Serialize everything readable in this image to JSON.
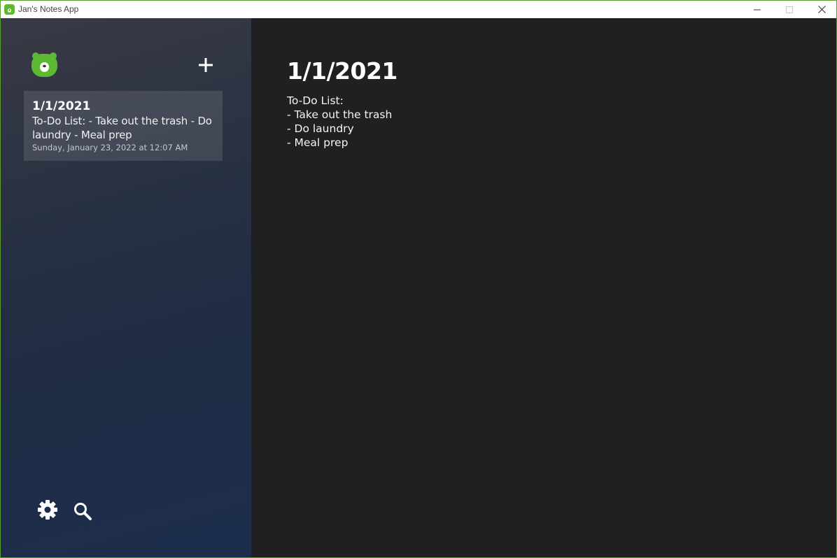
{
  "window": {
    "title": "Jan's Notes App",
    "border_color": "#5a9e2e",
    "controls": [
      "minimize-icon",
      "maximize-icon",
      "close-icon"
    ]
  },
  "sidebar": {
    "logo": "bear-logo-icon",
    "add_button_icon": "plus-icon",
    "notes": [
      {
        "title": "1/1/2021",
        "preview": "To-Do List: - Take out the trash - Do laundry - Meal prep",
        "date": "Sunday, January 23, 2022 at 12:07 AM"
      }
    ],
    "footer": {
      "settings_icon": "gear-icon",
      "search_icon": "search-icon"
    }
  },
  "editor": {
    "title": "1/1/2021",
    "body_lines": [
      "To-Do List:",
      "- Take out the trash",
      "- Do laundry",
      "- Meal prep"
    ]
  },
  "colors": {
    "accent": "#5fb832",
    "editor_bg": "#202020",
    "text": "#ffffff"
  }
}
